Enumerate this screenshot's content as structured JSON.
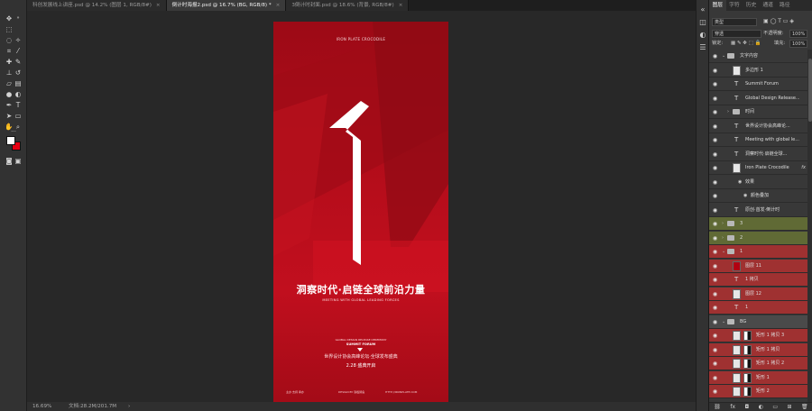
{
  "tabs": [
    {
      "label": "科创发展线上讲座.psd @ 14.2% (图层 1, RGB/8#)",
      "active": false
    },
    {
      "label": "倒计时海报2.psd @ 16.7% (BG, RGB/8) *",
      "active": true
    },
    {
      "label": "3倒计时封面.psd @ 18.6% (背景, RGB/8#)",
      "active": false
    }
  ],
  "statusbar": {
    "zoom": "16.69%",
    "doc": "文档:28.2M/201.7M",
    "arrow": "›"
  },
  "poster": {
    "brand": "IRON PLATE CROCODILE",
    "numeral": "1",
    "headline": "洞察时代·启链全球前沿力量",
    "subline": "MEETING WITH GLOBAL LEADING FORCES",
    "ceremony": "GLOBAL DESIGN RELEASE CEREMONY",
    "summit": "SUMMIT FORUM",
    "cn_event": "世界设计协会高峰论坛·全球发布盛典",
    "date": "2.28  盛典开启",
    "footer_left": "主办 支持 承办",
    "footer_mid": "DESIGN BY 铁板鳄鱼",
    "footer_right": "HTTP://IRONPLATE.COM"
  },
  "panel": {
    "tabs": [
      "图层",
      "字符",
      "历史",
      "通道",
      "路径"
    ],
    "filter_kind": "类型",
    "blend_mode": "穿透",
    "opacity_label": "不透明度:",
    "opacity_value": "100%",
    "lock_label": "锁定:",
    "fill_label": "填充:",
    "fill_value": "100%"
  },
  "layers": [
    {
      "name": "文字内容",
      "kind": "group",
      "indent": 0,
      "color": "none",
      "caret": "⌄"
    },
    {
      "name": "多边形 1",
      "kind": "shape",
      "indent": 1,
      "color": "none"
    },
    {
      "name": "Summit Forum",
      "kind": "text",
      "indent": 1,
      "color": "none"
    },
    {
      "name": "Global Design Release...",
      "kind": "text",
      "indent": 1,
      "color": "none"
    },
    {
      "name": "时间",
      "kind": "group",
      "indent": 1,
      "color": "none",
      "caret": "›"
    },
    {
      "name": "世界设计协会高峰论...",
      "kind": "text",
      "indent": 1,
      "color": "none"
    },
    {
      "name": "Meeting with global le...",
      "kind": "text",
      "indent": 1,
      "color": "none"
    },
    {
      "name": "洞察时代·启链全球...",
      "kind": "text",
      "indent": 1,
      "color": "none"
    },
    {
      "name": "Iron Plate Crocodile",
      "kind": "shape",
      "indent": 1,
      "color": "none",
      "fx": "fx"
    },
    {
      "name": "效果",
      "kind": "effect",
      "indent": 2,
      "color": "none"
    },
    {
      "name": "颜色叠加",
      "kind": "effect",
      "indent": 3,
      "color": "none"
    },
    {
      "name": "原创·首发·倒计时",
      "kind": "text",
      "indent": 1,
      "color": "none"
    },
    {
      "name": "3",
      "kind": "group",
      "indent": 0,
      "color": "green",
      "caret": "›"
    },
    {
      "name": "2",
      "kind": "group",
      "indent": 0,
      "color": "green",
      "caret": "›"
    },
    {
      "name": "1",
      "kind": "group",
      "indent": 0,
      "color": "red",
      "caret": "⌄"
    },
    {
      "name": "图层 11",
      "kind": "redthumb",
      "indent": 1,
      "color": "red"
    },
    {
      "name": "1 拷贝",
      "kind": "text",
      "indent": 1,
      "color": "red"
    },
    {
      "name": "图层 12",
      "kind": "shape",
      "indent": 1,
      "color": "red"
    },
    {
      "name": "1",
      "kind": "text",
      "indent": 1,
      "color": "red"
    },
    {
      "name": "BG",
      "kind": "group",
      "indent": 0,
      "color": "sel",
      "caret": "⌄"
    },
    {
      "name": "矩形 1 拷贝 3",
      "kind": "mask",
      "indent": 1,
      "color": "red"
    },
    {
      "name": "矩形 1 拷贝",
      "kind": "mask",
      "indent": 1,
      "color": "red"
    },
    {
      "name": "矩形 1 拷贝 2",
      "kind": "mask",
      "indent": 1,
      "color": "red"
    },
    {
      "name": "矩形 1",
      "kind": "mask",
      "indent": 1,
      "color": "red"
    },
    {
      "name": "矩形 2",
      "kind": "mask",
      "indent": 1,
      "color": "red"
    }
  ],
  "toolbar_icons": [
    "move-tool-icon",
    "marquee-tool-icon",
    "lasso-tool-icon",
    "magic-wand-icon",
    "crop-tool-icon",
    "eyedropper-icon",
    "healing-brush-icon",
    "brush-tool-icon",
    "clone-stamp-icon",
    "history-brush-icon",
    "eraser-icon",
    "gradient-tool-icon",
    "blur-tool-icon",
    "dodge-tool-icon",
    "pen-tool-icon",
    "type-tool-icon",
    "path-select-icon",
    "rectangle-tool-icon",
    "hand-tool-icon",
    "zoom-tool-icon"
  ],
  "colors": {
    "foreground": "#ffffff",
    "background": "#e60012",
    "poster_red": "#b70d1b",
    "layer_red_tag": "#9f3131",
    "layer_green_tag": "#606a35"
  }
}
